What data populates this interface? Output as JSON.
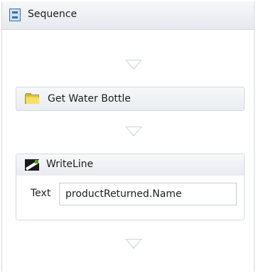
{
  "sequence": {
    "title": "Sequence",
    "icon": "sequence-icon"
  },
  "activities": {
    "get_water_bottle": {
      "title": "Get Water Bottle",
      "icon": "folder-icon"
    },
    "write_line": {
      "title": "WriteLine",
      "icon": "writeline-icon",
      "property_label": "Text",
      "property_value": "productReturned.Name"
    }
  }
}
